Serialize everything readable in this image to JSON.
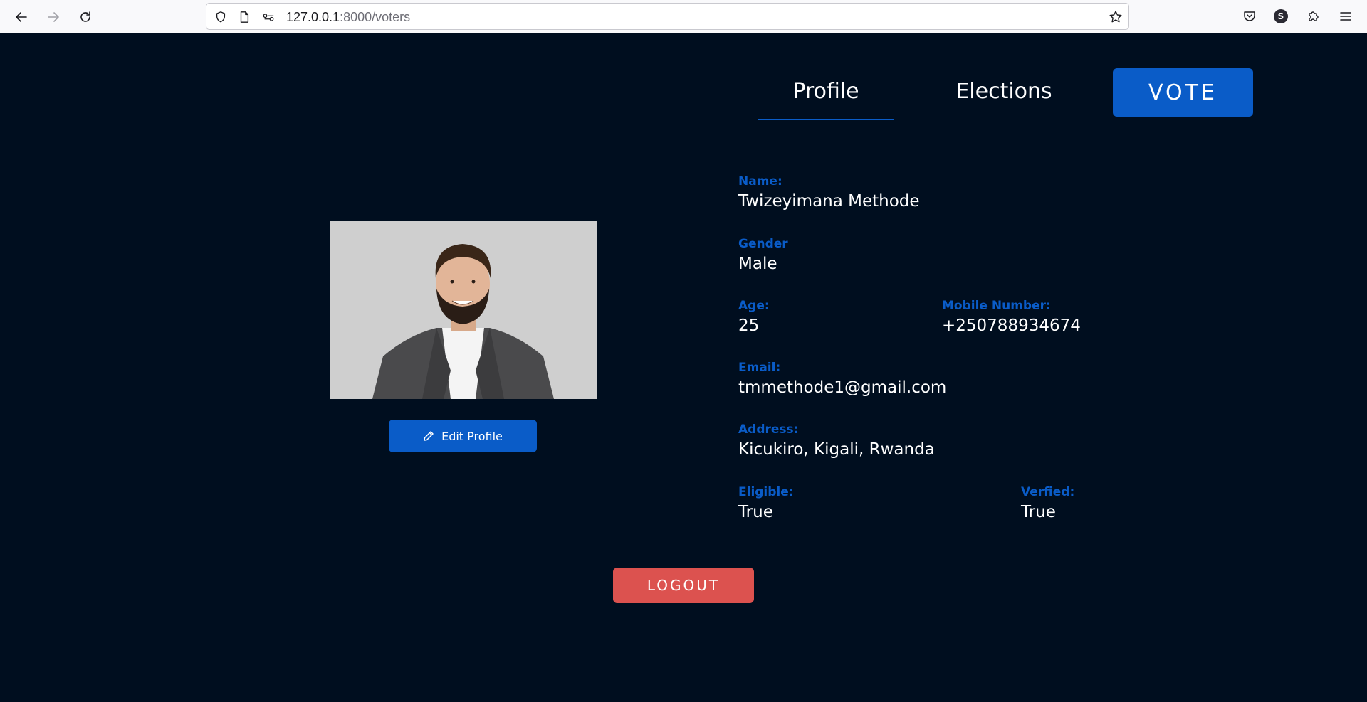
{
  "browser": {
    "url_host": "127.0.0.1",
    "url_rest": ":8000/voters",
    "account_initial": "S"
  },
  "nav": {
    "tabs": [
      {
        "label": "Profile",
        "active": true
      },
      {
        "label": "Elections",
        "active": false
      }
    ],
    "vote_label": "VOTE"
  },
  "profile": {
    "edit_label": "Edit Profile",
    "fields": {
      "name": {
        "label": "Name:",
        "value": "Twizeyimana Methode"
      },
      "gender": {
        "label": "Gender",
        "value": "Male"
      },
      "age": {
        "label": "Age:",
        "value": "25"
      },
      "mobile": {
        "label": "Mobile Number:",
        "value": "+250788934674"
      },
      "email": {
        "label": "Email:",
        "value": "tmmethode1@gmail.com"
      },
      "address": {
        "label": "Address:",
        "value": "Kicukiro, Kigali, Rwanda"
      },
      "eligible": {
        "label": "Eligible:",
        "value": "True"
      },
      "verified": {
        "label": "Verfied:",
        "value": "True"
      }
    }
  },
  "logout_label": "LOGOUT",
  "colors": {
    "background": "#000e1f",
    "accent": "#0a5cc8",
    "logout": "#dc524f"
  }
}
